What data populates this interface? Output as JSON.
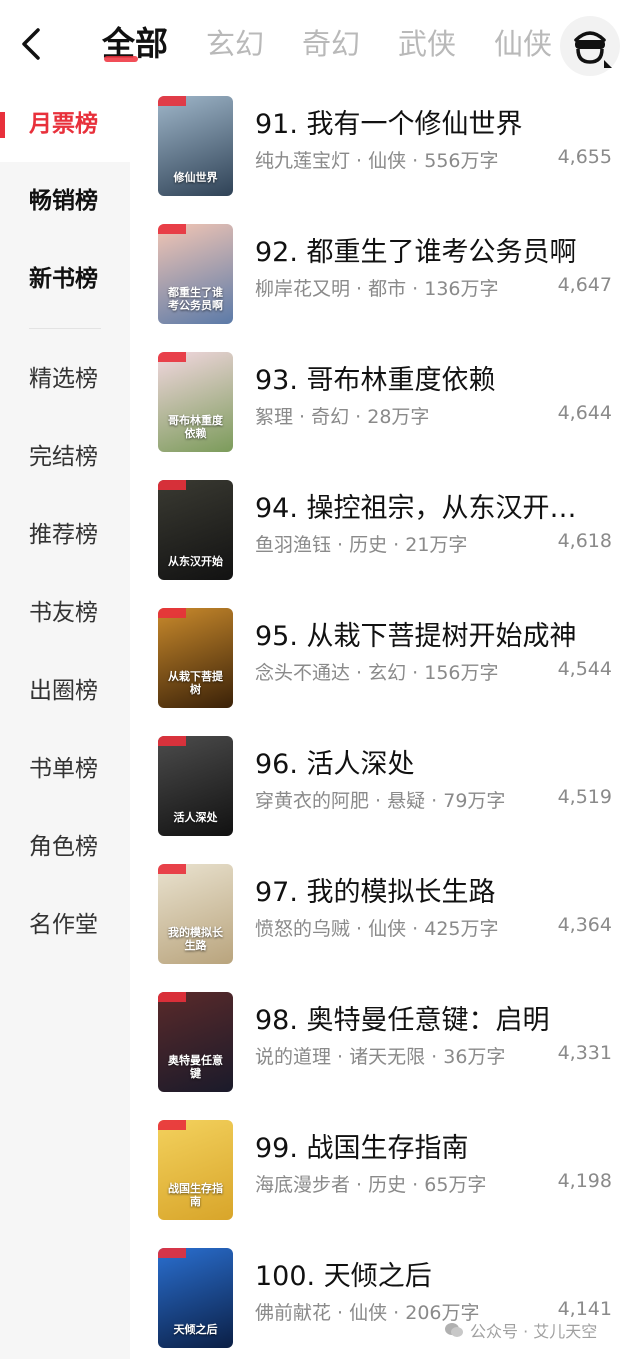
{
  "header": {
    "tabs": [
      {
        "label": "全部",
        "active": true
      },
      {
        "label": "玄幻",
        "active": false
      },
      {
        "label": "奇幻",
        "active": false
      },
      {
        "label": "武侠",
        "active": false
      },
      {
        "label": "仙侠",
        "active": false
      }
    ],
    "back_icon": "chevron-left-icon",
    "avatar_icon": "user-avatar-icon"
  },
  "sidebar": {
    "items": [
      {
        "label": "月票榜"
      },
      {
        "label": "畅销榜"
      },
      {
        "label": "新书榜"
      },
      {
        "label": "精选榜"
      },
      {
        "label": "完结榜"
      },
      {
        "label": "推荐榜"
      },
      {
        "label": "书友榜"
      },
      {
        "label": "出圈榜"
      },
      {
        "label": "书单榜"
      },
      {
        "label": "角色榜"
      },
      {
        "label": "名作堂"
      }
    ],
    "active_index": 0
  },
  "books": [
    {
      "title": "91. 我有一个修仙世界",
      "meta": "纯九莲宝灯 · 仙侠 · 556万字",
      "count": "4,655",
      "cover_text": "修仙世界",
      "cover_colors": [
        "#9fb6c9",
        "#2f4256"
      ]
    },
    {
      "title": "92. 都重生了谁考公务员啊",
      "meta": "柳岸花又明 · 都市 · 136万字",
      "count": "4,647",
      "cover_text": "都重生了谁考公务员啊",
      "cover_colors": [
        "#f3c6b4",
        "#5b7aa8"
      ]
    },
    {
      "title": "93. 哥布林重度依赖",
      "meta": "絮理 · 奇幻 · 28万字",
      "count": "4,644",
      "cover_text": "哥布林重度依赖",
      "cover_colors": [
        "#f2d7df",
        "#7b9b5a"
      ]
    },
    {
      "title": "94. 操控祖宗，从东汉开…",
      "meta": "鱼羽渔钰 · 历史 · 21万字",
      "count": "4,618",
      "cover_text": "从东汉开始",
      "cover_colors": [
        "#3a3a32",
        "#121212"
      ]
    },
    {
      "title": "95. 从栽下菩提树开始成神",
      "meta": "念头不通达 · 玄幻 · 156万字",
      "count": "4,544",
      "cover_text": "从栽下菩提树",
      "cover_colors": [
        "#c98a2c",
        "#3a2108"
      ]
    },
    {
      "title": "96. 活人深处",
      "meta": "穿黄衣的阿肥 · 悬疑 · 79万字",
      "count": "4,519",
      "cover_text": "活人深处",
      "cover_colors": [
        "#4c4c4c",
        "#111111"
      ]
    },
    {
      "title": "97. 我的模拟长生路",
      "meta": "愤怒的乌贼 · 仙侠 · 425万字",
      "count": "4,364",
      "cover_text": "我的模拟长生路",
      "cover_colors": [
        "#e9e2cf",
        "#b9a47d"
      ]
    },
    {
      "title": "98. 奥特曼任意键：启明",
      "meta": "说的道理 · 诸天无限 · 36万字",
      "count": "4,331",
      "cover_text": "奥特曼任意键",
      "cover_colors": [
        "#5a2a2a",
        "#1a1a2a"
      ]
    },
    {
      "title": "99. 战国生存指南",
      "meta": "海底漫步者 · 历史 · 65万字",
      "count": "4,198",
      "cover_text": "战国生存指南",
      "cover_colors": [
        "#f3d15d",
        "#d8a52a"
      ]
    },
    {
      "title": "100. 天倾之后",
      "meta": "佛前献花 · 仙侠 · 206万字",
      "count": "4,141",
      "cover_text": "天倾之后",
      "cover_colors": [
        "#2a6fd0",
        "#0b1f45"
      ]
    }
  ],
  "watermark": {
    "text": "公众号 · 艾儿天空",
    "icon": "wechat-icon"
  },
  "colors": {
    "accent": "#e8303b",
    "muted": "#8a8a8a",
    "sidebar_bg": "#f6f6f6"
  }
}
